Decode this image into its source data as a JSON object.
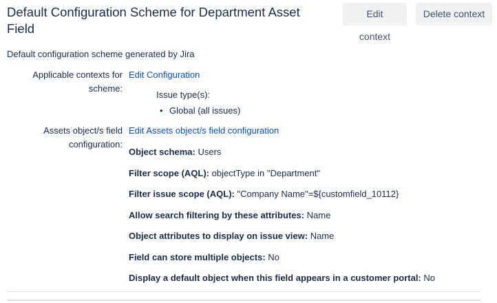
{
  "header": {
    "title": "Default Configuration Scheme for Department Asset Field",
    "edit_context_label": "Edit context",
    "delete_context_label": "Delete context"
  },
  "description": "Default configuration scheme generated by Jira",
  "contexts": {
    "label": "Applicable contexts for scheme:",
    "edit_link": "Edit Configuration",
    "issue_types_heading": "Issue type(s):",
    "issue_types": [
      "Global (all issues)"
    ]
  },
  "assets": {
    "label": "Assets object/s field configuration:",
    "edit_link": "Edit Assets object/s field configuration",
    "properties": [
      {
        "label": "Object schema:",
        "value": "Users"
      },
      {
        "label": "Filter scope (AQL):",
        "value": "objectType in \"Department\""
      },
      {
        "label": "Filter issue scope (AQL):",
        "value": "\"Company Name\"=${customfield_10112}"
      },
      {
        "label": "Allow search filtering by these attributes:",
        "value": "Name"
      },
      {
        "label": "Object attributes to display on issue view:",
        "value": "Name"
      },
      {
        "label": "Field can store multiple objects:",
        "value": "No"
      },
      {
        "label": "Display a default object when this field appears in a customer portal:",
        "value": "No"
      }
    ]
  }
}
